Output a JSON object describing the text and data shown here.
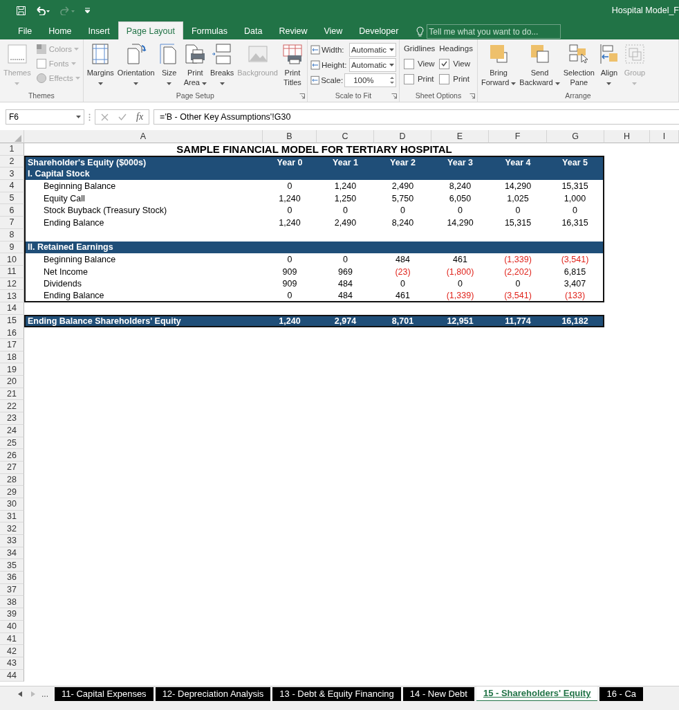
{
  "window": {
    "title": "Hospital Model_F"
  },
  "ribbon_tabs": [
    {
      "label": "File",
      "selected": false
    },
    {
      "label": "Home",
      "selected": false
    },
    {
      "label": "Insert",
      "selected": false
    },
    {
      "label": "Page Layout",
      "selected": true
    },
    {
      "label": "Formulas",
      "selected": false
    },
    {
      "label": "Data",
      "selected": false
    },
    {
      "label": "Review",
      "selected": false
    },
    {
      "label": "View",
      "selected": false
    },
    {
      "label": "Developer",
      "selected": false
    }
  ],
  "tell_me": {
    "placeholder": "Tell me what you want to do..."
  },
  "ribbon_groups": [
    {
      "kind": "themes",
      "label": "Themes",
      "launcher": false,
      "large": {
        "label": [
          "Themes"
        ],
        "dropdown": true,
        "disabled": true
      },
      "small": [
        {
          "label": "Colors",
          "disabled": true
        },
        {
          "label": "Fonts",
          "disabled": true
        },
        {
          "label": "Effects",
          "disabled": true
        }
      ]
    },
    {
      "kind": "buttons",
      "label": "Page Setup",
      "launcher": true,
      "buttons": [
        {
          "kind": "margins",
          "label": [
            "Margins"
          ],
          "dropdown": true,
          "disabled": false
        },
        {
          "kind": "orientation",
          "label": [
            "Orientation"
          ],
          "dropdown": true,
          "disabled": false
        },
        {
          "kind": "size",
          "label": [
            "Size"
          ],
          "dropdown": true,
          "disabled": false
        },
        {
          "kind": "print-area",
          "label": [
            "Print",
            "Area"
          ],
          "dropdown": true,
          "disabled": false
        },
        {
          "kind": "breaks",
          "label": [
            "Breaks"
          ],
          "dropdown": true,
          "disabled": false
        },
        {
          "kind": "background",
          "label": [
            "Background"
          ],
          "dropdown": false,
          "disabled": true
        },
        {
          "kind": "print-titles",
          "label": [
            "Print",
            "Titles"
          ],
          "dropdown": false,
          "disabled": false
        }
      ]
    },
    {
      "kind": "scale",
      "label": "Scale to Fit",
      "launcher": true,
      "fields": [
        {
          "kind": "dropdown",
          "label": "Width:",
          "value": "Automatic"
        },
        {
          "kind": "dropdown",
          "label": "Height:",
          "value": "Automatic"
        },
        {
          "kind": "spinner",
          "label": "Scale:",
          "value": "100%"
        }
      ]
    },
    {
      "kind": "options",
      "label": "Sheet Options",
      "launcher": true,
      "columns": [
        {
          "label": "Gridlines",
          "options": [
            {
              "label": "View",
              "checked": false
            },
            {
              "label": "Print",
              "checked": false
            }
          ]
        },
        {
          "label": "Headings",
          "options": [
            {
              "label": "View",
              "checked": true
            },
            {
              "label": "Print",
              "checked": false
            }
          ]
        }
      ]
    },
    {
      "kind": "buttons",
      "label": "Arrange",
      "launcher": false,
      "buttons": [
        {
          "kind": "bring-forward",
          "label": [
            "Bring",
            "Forward"
          ],
          "dropdown": true,
          "disabled": false
        },
        {
          "kind": "send-backward",
          "label": [
            "Send",
            "Backward"
          ],
          "dropdown": true,
          "disabled": false
        },
        {
          "kind": "selection-pane",
          "label": [
            "Selection",
            "Pane"
          ],
          "dropdown": false,
          "disabled": false
        },
        {
          "kind": "align",
          "label": [
            "Align"
          ],
          "dropdown": true,
          "disabled": false
        },
        {
          "kind": "group",
          "label": [
            "Group"
          ],
          "dropdown": true,
          "disabled": true
        }
      ]
    }
  ],
  "formula_bar": {
    "name_box": "F6",
    "function_label": "fx",
    "formula": "='B - Other Key Assumptions'!G30"
  },
  "sheet": {
    "columns": [
      "A",
      "B",
      "C",
      "D",
      "E",
      "F",
      "G",
      "H",
      "I"
    ],
    "rows": [
      {
        "number": "1",
        "kind": "title",
        "label": "SAMPLE FINANCIAL MODEL FOR TERTIARY HOSPITAL"
      },
      {
        "number": "2",
        "kind": "header",
        "label": "Shareholder's Equity ($000s)",
        "values": [
          "Year 0",
          "Year 1",
          "Year 2",
          "Year 3",
          "Year 4",
          "Year 5"
        ]
      },
      {
        "number": "3",
        "kind": "section",
        "label": "I.  Capital Stock"
      },
      {
        "number": "4",
        "kind": "item",
        "label": "Beginning Balance",
        "values": [
          {
            "text": "0",
            "negative": false
          },
          {
            "text": "1,240",
            "negative": false
          },
          {
            "text": "2,490",
            "negative": false
          },
          {
            "text": "8,240",
            "negative": false
          },
          {
            "text": "14,290",
            "negative": false
          },
          {
            "text": "15,315",
            "negative": false
          }
        ]
      },
      {
        "number": "5",
        "kind": "item",
        "label": "Equity Call",
        "values": [
          {
            "text": "1,240",
            "negative": false
          },
          {
            "text": "1,250",
            "negative": false
          },
          {
            "text": "5,750",
            "negative": false
          },
          {
            "text": "6,050",
            "negative": false
          },
          {
            "text": "1,025",
            "negative": false
          },
          {
            "text": "1,000",
            "negative": false
          }
        ]
      },
      {
        "number": "6",
        "kind": "item",
        "label": "Stock Buyback (Treasury Stock)",
        "values": [
          {
            "text": "0",
            "negative": false
          },
          {
            "text": "0",
            "negative": false
          },
          {
            "text": "0",
            "negative": false
          },
          {
            "text": "0",
            "negative": false
          },
          {
            "text": "0",
            "negative": false
          },
          {
            "text": "0",
            "negative": false
          }
        ]
      },
      {
        "number": "7",
        "kind": "item",
        "label": "Ending Balance",
        "values": [
          {
            "text": "1,240",
            "negative": false
          },
          {
            "text": "2,490",
            "negative": false
          },
          {
            "text": "8,240",
            "negative": false
          },
          {
            "text": "14,290",
            "negative": false
          },
          {
            "text": "15,315",
            "negative": false
          },
          {
            "text": "16,315",
            "negative": false
          }
        ]
      },
      {
        "number": "8",
        "kind": "spacer"
      },
      {
        "number": "9",
        "kind": "section",
        "label": "II.  Retained Earnings"
      },
      {
        "number": "10",
        "kind": "item",
        "label": "Beginning Balance",
        "values": [
          {
            "text": "0",
            "negative": false
          },
          {
            "text": "0",
            "negative": false
          },
          {
            "text": "484",
            "negative": false
          },
          {
            "text": "461",
            "negative": false
          },
          {
            "text": "(1,339)",
            "negative": true
          },
          {
            "text": "(3,541)",
            "negative": true
          }
        ]
      },
      {
        "number": "11",
        "kind": "item",
        "label": "Net Income",
        "values": [
          {
            "text": "909",
            "negative": false
          },
          {
            "text": "969",
            "negative": false
          },
          {
            "text": "(23)",
            "negative": true
          },
          {
            "text": "(1,800)",
            "negative": true
          },
          {
            "text": "(2,202)",
            "negative": true
          },
          {
            "text": "6,815",
            "negative": false
          }
        ]
      },
      {
        "number": "12",
        "kind": "item",
        "label": "Dividends",
        "values": [
          {
            "text": "909",
            "negative": false
          },
          {
            "text": "484",
            "negative": false
          },
          {
            "text": "0",
            "negative": false
          },
          {
            "text": "0",
            "negative": false
          },
          {
            "text": "0",
            "negative": false
          },
          {
            "text": "3,407",
            "negative": false
          }
        ]
      },
      {
        "number": "13",
        "kind": "item_last",
        "label": "Ending Balance",
        "values": [
          {
            "text": "0",
            "negative": false
          },
          {
            "text": "484",
            "negative": false
          },
          {
            "text": "461",
            "negative": false
          },
          {
            "text": "(1,339)",
            "negative": true
          },
          {
            "text": "(3,541)",
            "negative": true
          },
          {
            "text": "(133)",
            "negative": true
          }
        ]
      },
      {
        "number": "14",
        "kind": "empty"
      },
      {
        "number": "15",
        "kind": "total",
        "label": "Ending Balance Shareholders' Equity",
        "values": [
          "1,240",
          "2,974",
          "8,701",
          "12,951",
          "11,774",
          "16,182"
        ]
      },
      {
        "number": "16",
        "kind": "empty"
      },
      {
        "number": "17",
        "kind": "empty"
      },
      {
        "number": "18",
        "kind": "empty"
      },
      {
        "number": "19",
        "kind": "empty"
      },
      {
        "number": "20",
        "kind": "empty"
      },
      {
        "number": "21",
        "kind": "empty"
      },
      {
        "number": "22",
        "kind": "empty"
      },
      {
        "number": "23",
        "kind": "empty"
      },
      {
        "number": "24",
        "kind": "empty"
      },
      {
        "number": "25",
        "kind": "empty"
      },
      {
        "number": "26",
        "kind": "empty"
      },
      {
        "number": "27",
        "kind": "empty"
      },
      {
        "number": "28",
        "kind": "empty"
      },
      {
        "number": "29",
        "kind": "empty"
      },
      {
        "number": "30",
        "kind": "empty"
      },
      {
        "number": "31",
        "kind": "empty"
      },
      {
        "number": "32",
        "kind": "empty"
      },
      {
        "number": "33",
        "kind": "empty"
      },
      {
        "number": "34",
        "kind": "empty"
      },
      {
        "number": "35",
        "kind": "empty"
      },
      {
        "number": "36",
        "kind": "empty"
      },
      {
        "number": "37",
        "kind": "empty"
      },
      {
        "number": "38",
        "kind": "empty"
      },
      {
        "number": "39",
        "kind": "empty"
      },
      {
        "number": "40",
        "kind": "empty"
      },
      {
        "number": "41",
        "kind": "empty"
      },
      {
        "number": "42",
        "kind": "empty"
      },
      {
        "number": "43",
        "kind": "empty"
      },
      {
        "number": "44",
        "kind": "empty"
      }
    ]
  },
  "sheet_tabs": {
    "overflow": "...",
    "tabs": [
      {
        "label": "11- Capital Expenses",
        "selected": false
      },
      {
        "label": "12- Depreciation Analysis",
        "selected": false
      },
      {
        "label": "13 - Debt & Equity Financing",
        "selected": false
      },
      {
        "label": "14 - New Debt",
        "selected": false
      },
      {
        "label": "15 - Shareholders' Equity",
        "selected": true
      },
      {
        "label": "16 - Ca",
        "selected": false
      }
    ]
  }
}
